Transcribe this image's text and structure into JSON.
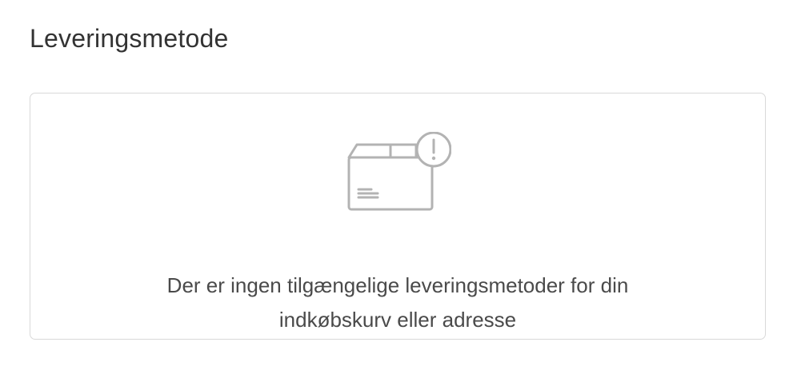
{
  "section": {
    "title": "Leveringsmetode"
  },
  "empty_state": {
    "icon": "package-warning-icon",
    "message_line1": "Der er ingen tilgængelige leveringsmetoder for din",
    "message_line2": "indkøbskurv eller adresse"
  },
  "colors": {
    "text": "#333333",
    "border": "#d9d9d9",
    "icon": "#b3b3b3"
  }
}
